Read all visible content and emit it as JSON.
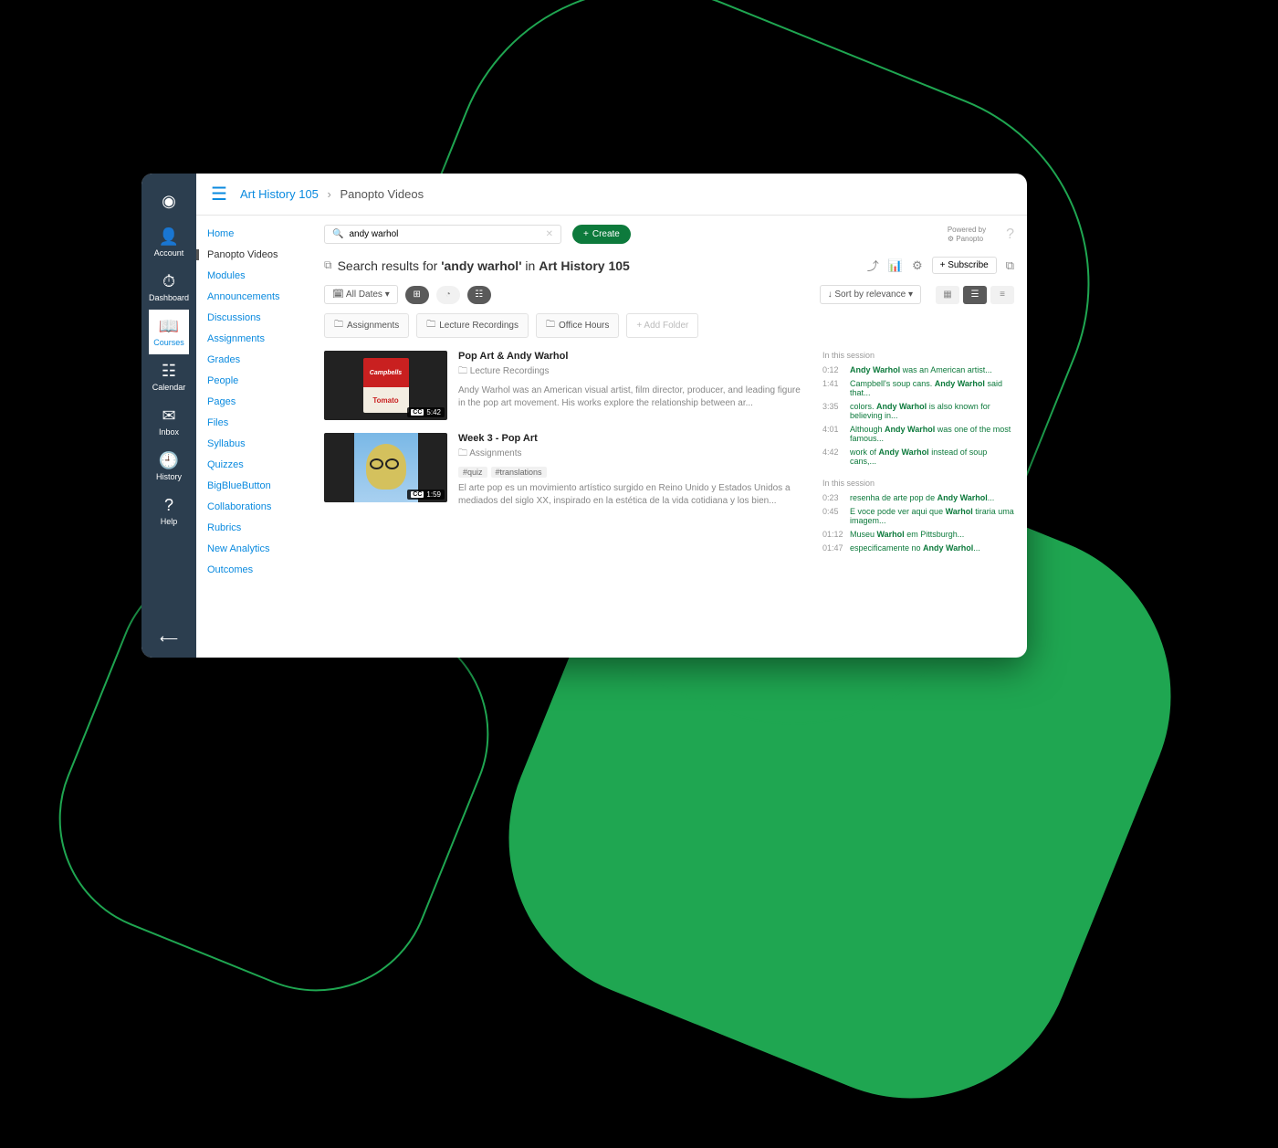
{
  "nav_rail": [
    {
      "label": "",
      "icon": "◉",
      "name": "logo-icon"
    },
    {
      "label": "Account",
      "icon": "👤",
      "name": "account"
    },
    {
      "label": "Dashboard",
      "icon": "⏱",
      "name": "dashboard"
    },
    {
      "label": "Courses",
      "icon": "📖",
      "name": "courses",
      "active": true
    },
    {
      "label": "Calendar",
      "icon": "☷",
      "name": "calendar"
    },
    {
      "label": "Inbox",
      "icon": "✉",
      "name": "inbox"
    },
    {
      "label": "History",
      "icon": "🕘",
      "name": "history"
    },
    {
      "label": "Help",
      "icon": "?",
      "name": "help"
    }
  ],
  "breadcrumb": {
    "course": "Art History 105",
    "page": "Panopto Videos"
  },
  "course_nav": [
    {
      "label": "Home"
    },
    {
      "label": "Panopto Videos",
      "active": true
    },
    {
      "label": "Modules"
    },
    {
      "label": "Announcements"
    },
    {
      "label": "Discussions"
    },
    {
      "label": "Assignments"
    },
    {
      "label": "Grades"
    },
    {
      "label": "People"
    },
    {
      "label": "Pages"
    },
    {
      "label": "Files"
    },
    {
      "label": "Syllabus"
    },
    {
      "label": "Quizzes"
    },
    {
      "label": "BigBlueButton"
    },
    {
      "label": "Collaborations"
    },
    {
      "label": "Rubrics"
    },
    {
      "label": "New Analytics"
    },
    {
      "label": "Outcomes"
    }
  ],
  "search": {
    "value": "andy warhol"
  },
  "create_label": "Create",
  "powered_by": "Powered by",
  "brand": "Panopto",
  "results_header": {
    "prefix": "Search results for ",
    "query": "'andy warhol'",
    "mid": " in ",
    "context": "Art History 105"
  },
  "subscribe_label": "Subscribe",
  "filters": {
    "dates": "All Dates",
    "sort": "Sort by relevance"
  },
  "folders": [
    {
      "label": "Assignments"
    },
    {
      "label": "Lecture Recordings"
    },
    {
      "label": "Office Hours"
    }
  ],
  "add_folder_label": "Add Folder",
  "videos": [
    {
      "title": "Pop Art & Andy Warhol",
      "folder": "Lecture Recordings",
      "desc": "Andy Warhol was an American visual artist, film director, producer, and leading figure in the pop art movement. His works explore the relationship between ar...",
      "duration": "5:42",
      "cc": "CC",
      "session_label": "In this session",
      "transcript": [
        {
          "t": "0:12",
          "html": "<b>Andy Warhol</b> was an American artist..."
        },
        {
          "t": "1:41",
          "html": "Campbell's soup cans. <b>Andy Warhol</b> said that..."
        },
        {
          "t": "3:35",
          "html": "colors. <b>Andy Warhol</b> is also known for believing in..."
        },
        {
          "t": "4:01",
          "html": "Although <b>Andy Warhol</b> was one of the most famous..."
        },
        {
          "t": "4:42",
          "html": "work of <b>Andy Warhol</b> instead of soup cans,..."
        }
      ]
    },
    {
      "title": "Week 3 - Pop Art",
      "folder": "Assignments",
      "tags": [
        "#quiz",
        "#translations"
      ],
      "desc": "El arte pop es un movimiento artístico surgido en Reino Unido y Estados Unidos a mediados del siglo XX, inspirado en la estética de la vida cotidiana y los bien...",
      "duration": "1:59",
      "cc": "CC",
      "session_label": "In this session",
      "transcript": [
        {
          "t": "0:23",
          "html": "resenha de arte pop de <b>Andy Warhol</b>..."
        },
        {
          "t": "0:45",
          "html": "E voce pode ver aqui que <b>Warhol</b> tiraria uma imagem..."
        },
        {
          "t": "01:12",
          "html": "Museu <b>Warhol</b> em Pittsburgh..."
        },
        {
          "t": "01:47",
          "html": "especificamente no <b>Andy Warhol</b>..."
        }
      ]
    }
  ],
  "thumb_labels": {
    "campbells": "Campbells",
    "tomato": "Tomato"
  }
}
